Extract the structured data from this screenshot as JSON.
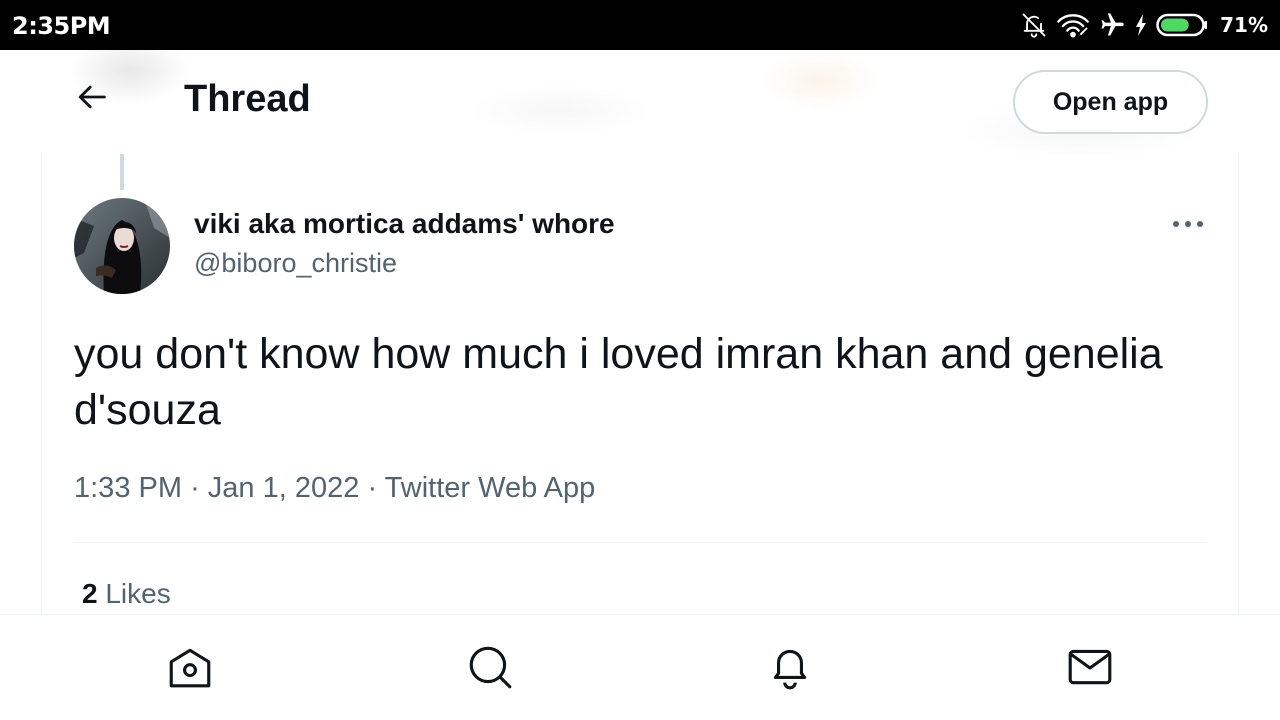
{
  "status_bar": {
    "time": "2:35PM",
    "battery_percent": "71%",
    "battery_level": 0.71,
    "battery_color": "#4cd964",
    "icons": [
      "bell-muted-icon",
      "wifi-icon",
      "airplane-icon",
      "charging-bolt-icon",
      "battery-icon"
    ]
  },
  "header": {
    "back_icon": "arrow-left-icon",
    "title": "Thread",
    "open_app_label": "Open app"
  },
  "tweet": {
    "author_name": "viki aka mortica addams' whore",
    "author_handle": "@biboro_christie",
    "text": "you don't know how much i loved imran khan and genelia d'souza",
    "time": "1:33 PM",
    "separator": "·",
    "date": "Jan 1, 2022",
    "source": "Twitter Web App",
    "likes_count": "2",
    "likes_label": "Likes",
    "more_icon": "more-horizontal-icon"
  },
  "bottom_nav": {
    "items": [
      {
        "name": "home",
        "icon": "home-icon"
      },
      {
        "name": "explore",
        "icon": "search-icon"
      },
      {
        "name": "notifications",
        "icon": "bell-icon"
      },
      {
        "name": "messages",
        "icon": "mail-icon"
      }
    ]
  },
  "colors": {
    "text_primary": "#0f1419",
    "text_secondary": "#536471",
    "border": "#cfd9de",
    "divider": "#eff3f4",
    "status_bar_bg": "#000000"
  }
}
